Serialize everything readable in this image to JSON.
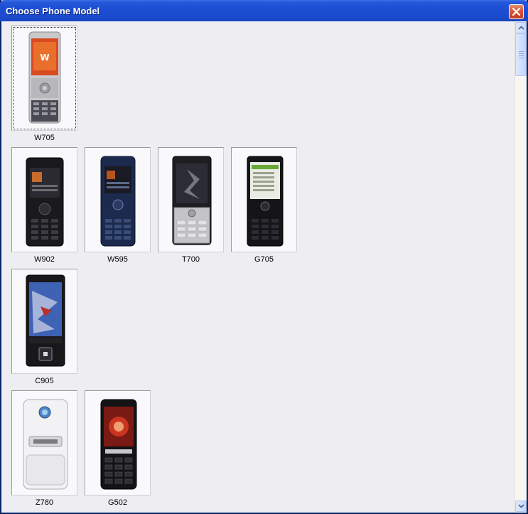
{
  "window": {
    "title": "Choose Phone Model"
  },
  "models": [
    {
      "name": "W705",
      "selected": true
    },
    {
      "name": "W902"
    },
    {
      "name": "W595"
    },
    {
      "name": "T700"
    },
    {
      "name": "G705"
    },
    {
      "name": "C905"
    },
    {
      "name": "Z780"
    },
    {
      "name": "G502"
    }
  ],
  "colors": {
    "titlebar": "#1d4fd4",
    "close": "#d8553a",
    "background": "#eeedf2"
  }
}
